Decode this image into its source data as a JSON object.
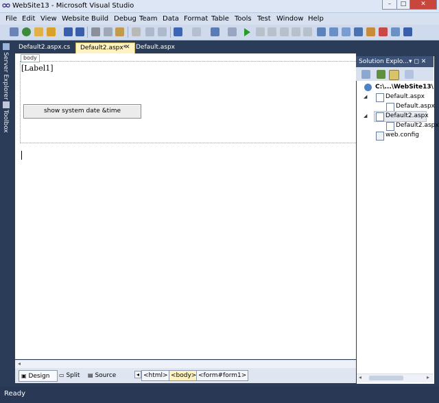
{
  "window": {
    "title": "WebSite13 - Microsoft Visual Studio",
    "min": "–",
    "max": "□",
    "close": "✕"
  },
  "menu": [
    "File",
    "Edit",
    "View",
    "Website",
    "Build",
    "Debug",
    "Team",
    "Data",
    "Format",
    "Table",
    "Tools",
    "Test",
    "Window",
    "Help"
  ],
  "tabs": [
    {
      "label": "Default2.aspx.cs"
    },
    {
      "label": "Default2.aspx*",
      "close": "✕"
    },
    {
      "label": "Default.aspx"
    }
  ],
  "left_strip": {
    "server_explorer": "Server Explorer",
    "toolbox": "Toolbox"
  },
  "designer": {
    "body_tag": "body",
    "label": "[Label1]",
    "button": "show system date &time"
  },
  "view_bar": {
    "design": "Design",
    "split": "Split",
    "source": "Source",
    "crumbs": [
      "<html>",
      "<body>",
      "<form#form1>"
    ]
  },
  "solution_explorer": {
    "title": "Solution Explo...",
    "pin": "▾ ◻ ✕",
    "items": [
      {
        "label": "C:\\...\\WebSite13\\",
        "icon": "website-icon"
      },
      {
        "label": "Default.aspx",
        "icon": "aspx-file-icon"
      },
      {
        "label": "Default.aspx",
        "icon": "cs-file-icon"
      },
      {
        "label": "Default2.aspx",
        "icon": "aspx-file-icon"
      },
      {
        "label": "Default2.aspx",
        "icon": "cs-file-icon"
      },
      {
        "label": "web.config",
        "icon": "config-file-icon"
      }
    ]
  },
  "status": {
    "text": "Ready"
  },
  "colors": {
    "accent": "#2b3c59",
    "active_tab": "#fdf2c0"
  }
}
